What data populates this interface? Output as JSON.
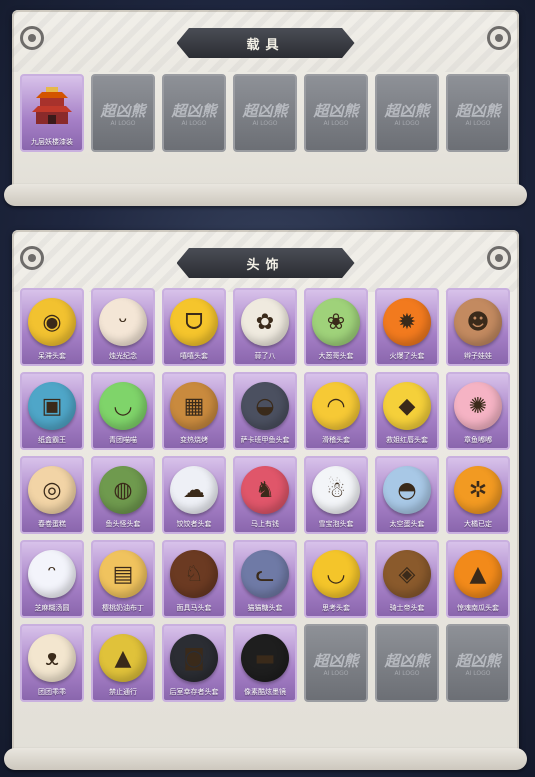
{
  "vehicle": {
    "title": "载具",
    "items": [
      {
        "name": "九层妖楼漆装",
        "owned": true,
        "icon": "pagoda-icon"
      },
      {
        "name": "",
        "owned": false,
        "placeholder": "超凶熊",
        "sub": "AI LOGO"
      },
      {
        "name": "",
        "owned": false,
        "placeholder": "超凶熊",
        "sub": "AI LOGO"
      },
      {
        "name": "",
        "owned": false,
        "placeholder": "超凶熊",
        "sub": "AI LOGO"
      },
      {
        "name": "",
        "owned": false,
        "placeholder": "超凶熊",
        "sub": "AI LOGO"
      },
      {
        "name": "",
        "owned": false,
        "placeholder": "超凶熊",
        "sub": "AI LOGO"
      },
      {
        "name": "",
        "owned": false,
        "placeholder": "超凶熊",
        "sub": "AI LOGO"
      }
    ]
  },
  "headwear": {
    "title": "头饰",
    "items": [
      {
        "name": "呆滞头套",
        "owned": true,
        "icon": "dazed-face-icon",
        "color": "#f2c230",
        "glyph": "◉"
      },
      {
        "name": "烛光纪念",
        "owned": true,
        "icon": "candle-face-icon",
        "color": "#f4e6d6",
        "glyph": "ᵕ"
      },
      {
        "name": "嘻嘻头套",
        "owned": true,
        "icon": "grin-face-icon",
        "color": "#f5c52c",
        "glyph": "ᗜ"
      },
      {
        "name": "蒜了八",
        "owned": true,
        "icon": "garlic-icon",
        "color": "#efeadf",
        "glyph": "✿"
      },
      {
        "name": "大葱哥头套",
        "owned": true,
        "icon": "scallion-icon",
        "color": "#9fd27a",
        "glyph": "❀"
      },
      {
        "name": "火爆了头套",
        "owned": true,
        "icon": "fire-face-icon",
        "color": "#f27a1e",
        "glyph": "✹"
      },
      {
        "name": "辫子娃娃",
        "owned": true,
        "icon": "doll-face-icon",
        "color": "#c38a60",
        "glyph": "☻"
      },
      {
        "name": "纸盒霸王",
        "owned": true,
        "icon": "box-monster-icon",
        "color": "#4fa6c8",
        "glyph": "▣"
      },
      {
        "name": "青团喵喵",
        "owned": true,
        "icon": "green-bun-icon",
        "color": "#7fd46a",
        "glyph": "◡"
      },
      {
        "name": "变热烧烤",
        "owned": true,
        "icon": "toast-face-icon",
        "color": "#c98a3e",
        "glyph": "▦"
      },
      {
        "name": "萨卡班甲鱼头套",
        "owned": true,
        "icon": "fish-head-icon",
        "color": "#4b5060",
        "glyph": "◒"
      },
      {
        "name": "滑稽头套",
        "owned": true,
        "icon": "smirk-face-icon",
        "color": "#f6c935",
        "glyph": "◠"
      },
      {
        "name": "救姐红唇头套",
        "owned": true,
        "icon": "pikachu-glasses-icon",
        "color": "#f5d03a",
        "glyph": "◆"
      },
      {
        "name": "章鱼嘟嘟",
        "owned": true,
        "icon": "octopus-icon",
        "color": "#f5b3c4",
        "glyph": "✺"
      },
      {
        "name": "春卷蛋糕",
        "owned": true,
        "icon": "roll-cake-icon",
        "color": "#f2d4a6",
        "glyph": "◎"
      },
      {
        "name": "鱼头怪头套",
        "owned": true,
        "icon": "fish-monster-icon",
        "color": "#6f9a4e",
        "glyph": "◍"
      },
      {
        "name": "饺饺者头套",
        "owned": true,
        "icon": "cloud-face-icon",
        "color": "#eef0f6",
        "glyph": "☁"
      },
      {
        "name": "马上有钱",
        "owned": true,
        "icon": "horse-pink-icon",
        "color": "#e0566a",
        "glyph": "♞"
      },
      {
        "name": "雪宝泡头套",
        "owned": true,
        "icon": "snowman-icon",
        "color": "#f3f5f8",
        "glyph": "☃"
      },
      {
        "name": "太空蛋头套",
        "owned": true,
        "icon": "shark-ghost-icon",
        "color": "#a8c8e6",
        "glyph": "◓"
      },
      {
        "name": "大橘已定",
        "owned": true,
        "icon": "orange-slice-icon",
        "color": "#f29a22",
        "glyph": "✲"
      },
      {
        "name": "芝麻糊汤圆",
        "owned": true,
        "icon": "mochi-icon",
        "color": "#f3f4fb",
        "glyph": "ᵔ"
      },
      {
        "name": "樱桃奶油布丁",
        "owned": true,
        "icon": "pudding-icon",
        "color": "#f0c35e",
        "glyph": "▤"
      },
      {
        "name": "面具马头套",
        "owned": true,
        "icon": "horse-mask-icon",
        "color": "#6b3a22",
        "glyph": "♘"
      },
      {
        "name": "猫猫糖头套",
        "owned": true,
        "icon": "cat-face-icon",
        "color": "#6f7aa6",
        "glyph": "ᓚ"
      },
      {
        "name": "思考头套",
        "owned": true,
        "icon": "pensive-face-icon",
        "color": "#f4c52a",
        "glyph": "◡"
      },
      {
        "name": "骑士帝头套",
        "owned": true,
        "icon": "dog-sunglasses-icon",
        "color": "#8a5a2c",
        "glyph": "◈"
      },
      {
        "name": "惊魂南瓜头套",
        "owned": true,
        "icon": "pumpkin-icon",
        "color": "#f28a1a",
        "glyph": "▲"
      },
      {
        "name": "团团乖乖",
        "owned": true,
        "icon": "hamster-icon",
        "color": "#f3e6cf",
        "glyph": "ᴥ"
      },
      {
        "name": "禁止通行",
        "owned": true,
        "icon": "traffic-cone-icon",
        "color": "#e0c23a",
        "glyph": "▲"
      },
      {
        "name": "后室幸存者头套",
        "owned": true,
        "icon": "gas-mask-icon",
        "color": "#2b2d33",
        "glyph": "◙"
      },
      {
        "name": "像素酷炫墨镜",
        "owned": true,
        "icon": "pixel-sunglasses-icon",
        "color": "#1e1e1e",
        "glyph": "▬"
      },
      {
        "name": "",
        "owned": false,
        "placeholder": "超凶熊",
        "sub": "AI LOGO"
      },
      {
        "name": "",
        "owned": false,
        "placeholder": "超凶熊",
        "sub": "AI LOGO"
      },
      {
        "name": "",
        "owned": false,
        "placeholder": "超凶熊",
        "sub": "AI LOGO"
      }
    ]
  }
}
